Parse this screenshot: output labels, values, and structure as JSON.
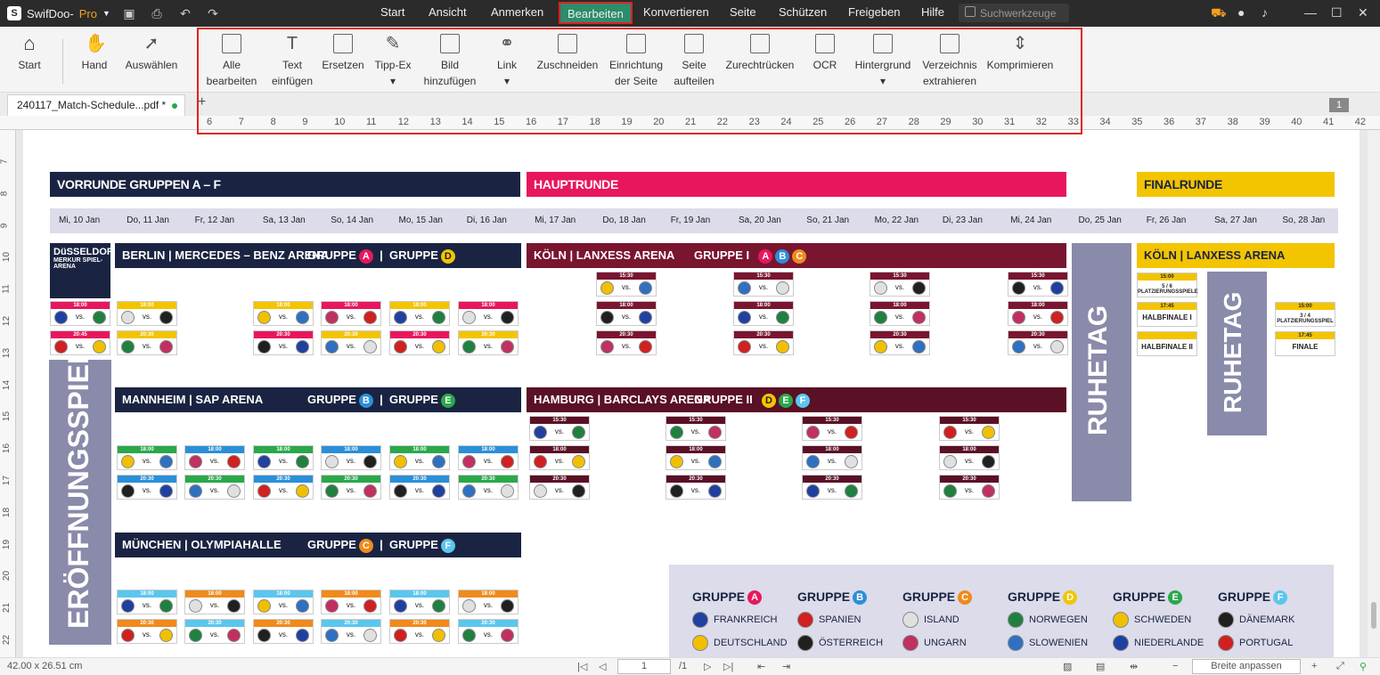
{
  "app": {
    "name": "SwifDoo-",
    "edition": "Pro"
  },
  "menu": [
    "Start",
    "Ansicht",
    "Anmerken",
    "Bearbeiten",
    "Konvertieren",
    "Seite",
    "Schützen",
    "Freigeben",
    "Hilfe"
  ],
  "search_placeholder": "Suchwerkzeuge",
  "ribbon_left": [
    "Start",
    "Hand",
    "Auswählen"
  ],
  "ribbon_tools": [
    {
      "l1": "Alle",
      "l2": "bearbeiten ▾"
    },
    {
      "l1": "Text",
      "l2": "einfügen"
    },
    {
      "l1": "Ersetzen",
      "l2": ""
    },
    {
      "l1": "Tipp-Ex",
      "l2": "▾"
    },
    {
      "l1": "Bild",
      "l2": "hinzufügen"
    },
    {
      "l1": "Link",
      "l2": "▾"
    },
    {
      "l1": "Zuschneiden",
      "l2": ""
    },
    {
      "l1": "Einrichtung",
      "l2": "der Seite"
    },
    {
      "l1": "Seite",
      "l2": "aufteilen"
    },
    {
      "l1": "Zurechtrücken",
      "l2": ""
    },
    {
      "l1": "OCR",
      "l2": ""
    },
    {
      "l1": "Hintergrund",
      "l2": "▾"
    },
    {
      "l1": "Verzeichnis",
      "l2": "extrahieren"
    },
    {
      "l1": "Komprimieren",
      "l2": ""
    }
  ],
  "doc_tab": "240117_Match-Schedule...pdf *",
  "page_badge": "1",
  "hruler": [
    "6",
    "7",
    "8",
    "9",
    "10",
    "11",
    "12",
    "13",
    "14",
    "15",
    "16",
    "17",
    "18",
    "19",
    "20",
    "21",
    "22",
    "23",
    "24",
    "25",
    "26",
    "27",
    "28",
    "29",
    "30",
    "31",
    "32",
    "33",
    "34",
    "35",
    "36",
    "37",
    "38",
    "39",
    "40",
    "41",
    "42"
  ],
  "vruler": [
    "7",
    "8",
    "9",
    "10",
    "11",
    "12",
    "13",
    "14",
    "15",
    "16",
    "17",
    "18",
    "19",
    "20",
    "21",
    "22"
  ],
  "doc": {
    "vorrunde": "VORRUNDE GRUPPEN A – F",
    "hauptrunde": "HAUPTRUNDE",
    "finalrunde": "FINALRUNDE",
    "dates": [
      "Mi, 10 Jan",
      "Do, 11 Jan",
      "Fr, 12 Jan",
      "Sa, 13 Jan",
      "So, 14 Jan",
      "Mo, 15 Jan",
      "Di, 16 Jan",
      "Mi, 17 Jan",
      "Do, 18 Jan",
      "Fr, 19 Jan",
      "Sa, 20 Jan",
      "So, 21 Jan",
      "Mo, 22 Jan",
      "Di, 23 Jan",
      "Mi, 24 Jan",
      "Do, 25 Jan",
      "Fr, 26 Jan",
      "Sa, 27 Jan",
      "So, 28 Jan"
    ],
    "duesseldorf": "DüSSELDORF",
    "duesseldorf_sub": "MERKUR SPIEL-ARENA",
    "berlin": "BERLIN | MERCEDES – BENZ ARENA",
    "mannheim": "MANNHEIM | SAP ARENA",
    "muenchen": "MÜNCHEN | OLYMPIAHALLE",
    "koeln_main": "KÖLN | LANXESS ARENA",
    "hamburg": "HAMBURG | BARCLAYS ARENA",
    "koeln_final": "KÖLN | LANXESS ARENA",
    "gruppe": "GRUPPE",
    "gruppe_i": "GRUPPE I",
    "gruppe_ii": "GRUPPE II",
    "letters": {
      "a": "A",
      "b": "B",
      "c": "C",
      "d": "D",
      "e": "E",
      "f": "F"
    },
    "vs": "vs.",
    "eroeffnung": "ERÖFFNUNGSSPIEL",
    "ruhetag": "RUHETAG",
    "final_cards": [
      {
        "t": "15:00",
        "l": "5 / 6 PLATZIERUNGSSPIELE"
      },
      {
        "t": "17:45",
        "l": "HALBFINALE I"
      },
      {
        "t": "",
        "l": "HALBFINALE II"
      },
      {
        "t": "15:00",
        "l": "3 / 4 PLATZIERUNGSSPIEL"
      },
      {
        "t": "17:45",
        "l": "FINALE"
      }
    ],
    "legend": [
      {
        "g": "GRUPPE",
        "l": "A",
        "c": "#e8175d",
        "n1": "FRANKREICH",
        "n2": "DEUTSCHLAND"
      },
      {
        "g": "GRUPPE",
        "l": "B",
        "c": "#2a8fd8",
        "n1": "SPANIEN",
        "n2": "ÖSTERREICH"
      },
      {
        "g": "GRUPPE",
        "l": "C",
        "c": "#f08a1c",
        "n1": "ISLAND",
        "n2": "UNGARN"
      },
      {
        "g": "GRUPPE",
        "l": "D",
        "c": "#f3c400",
        "n1": "NORWEGEN",
        "n2": "SLOWENIEN"
      },
      {
        "g": "GRUPPE",
        "l": "E",
        "c": "#2aa84a",
        "n1": "SCHWEDEN",
        "n2": "NIEDERLANDE"
      },
      {
        "g": "GRUPPE",
        "l": "F",
        "c": "#5bc6ee",
        "n1": "DÄNEMARK",
        "n2": "PORTUGAL"
      }
    ],
    "times": {
      "t1800": "18:00",
      "t2030": "20:30",
      "t2045": "20:45",
      "t1530": "15:30"
    }
  },
  "status": {
    "size": "42.00 x 26.51 cm",
    "page": "1",
    "total": "/1",
    "fit": "Breite anpassen"
  },
  "colors": {
    "navy": "#1a2442",
    "pink": "#e8175d",
    "yellow": "#f3c400",
    "maroon": "#7a1530",
    "darkred": "#5a1025",
    "grey": "#8a8aaa"
  }
}
